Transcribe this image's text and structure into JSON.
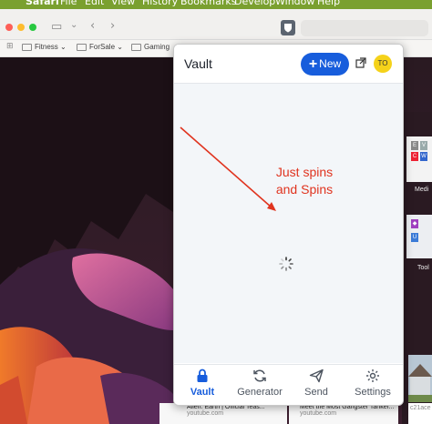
{
  "menubar": {
    "items": [
      "Safari",
      "File",
      "Edit",
      "View",
      "History",
      "Bookmarks",
      "Develop",
      "Window",
      "Help"
    ]
  },
  "favorites": [
    "Fitness",
    "ForSale",
    "Gaming"
  ],
  "extension_icon": "shield-icon",
  "vault": {
    "title": "Vault",
    "new_button": "New",
    "avatar_initials": "TO",
    "nav": [
      {
        "label": "Vault",
        "icon": "lock-icon",
        "active": true
      },
      {
        "label": "Generator",
        "icon": "generate-icon",
        "active": false
      },
      {
        "label": "Send",
        "icon": "send-icon",
        "active": false
      },
      {
        "label": "Settings",
        "icon": "gear-icon",
        "active": false
      }
    ]
  },
  "annotation": {
    "text": "Just spins and Spins",
    "color": "#e0341f"
  },
  "right_tiles": {
    "label_top": "Medi",
    "label_bottom": "Tool"
  },
  "videos": [
    {
      "title": "Alien: Earth | Official Teas...",
      "source": "youtube.com"
    },
    {
      "title": "Meet the Most Gangster Tanker...",
      "source": "youtube.com"
    },
    {
      "title": "",
      "source": "c21ace"
    }
  ],
  "colors": {
    "bitwarden_blue": "#175ddc",
    "menubar": "#7aa02f"
  }
}
